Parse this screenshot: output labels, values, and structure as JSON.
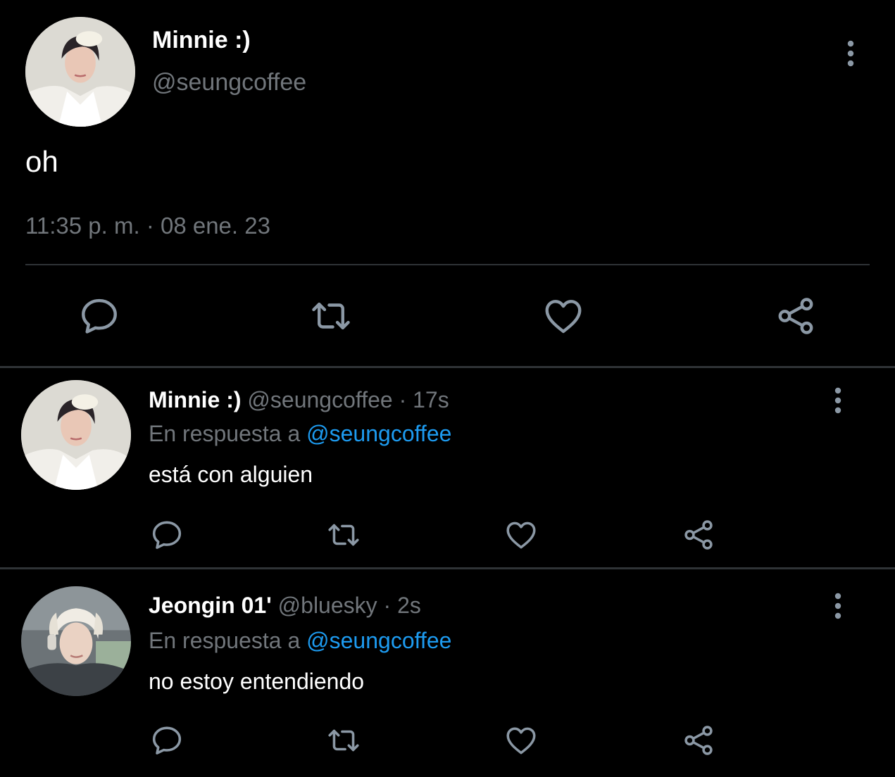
{
  "main_tweet": {
    "display_name": "Minnie :)",
    "handle": "@seungcoffee",
    "text": "oh",
    "timestamp": "11:35 p. m. · 08 ene. 23"
  },
  "replies": [
    {
      "display_name": "Minnie :)",
      "meta": "@seungcoffee · 17s",
      "reply_prefix": "En respuesta a",
      "reply_to": "@seungcoffee",
      "text": "está con alguien"
    },
    {
      "display_name": "Jeongin 01'",
      "meta": "@bluesky · 2s",
      "reply_prefix": "En respuesta a",
      "reply_to": "@seungcoffee",
      "text": "no estoy entendiendo"
    }
  ],
  "icons": {
    "reply": "speech-bubble-icon",
    "retweet": "retweet-icon",
    "like": "heart-icon",
    "share": "share-icon",
    "menu": "vertical-dots-icon"
  },
  "colors": {
    "background": "#000000",
    "text_primary": "#ffffff",
    "text_secondary": "#71767b",
    "link": "#1d9bf0",
    "icon": "#8b98a5",
    "divider": "#2f3336"
  }
}
